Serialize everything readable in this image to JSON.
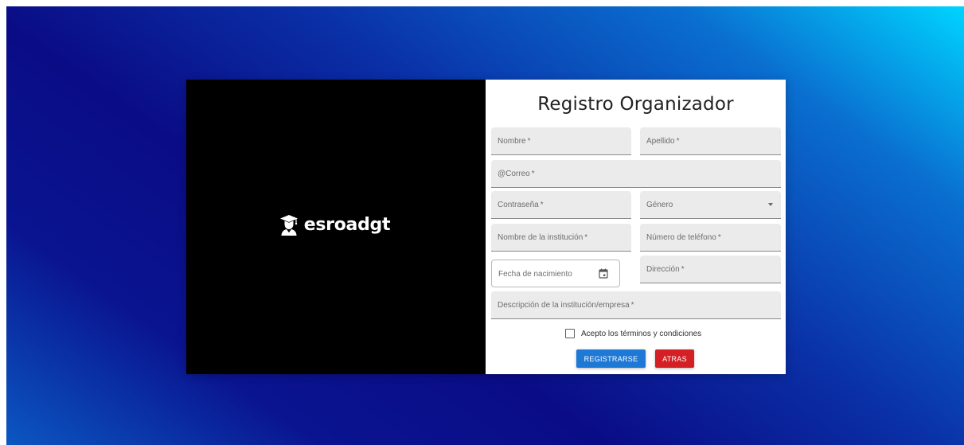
{
  "brand": {
    "name": "esroadgt",
    "logo": "graduate-logo-icon"
  },
  "form": {
    "title": "Registro Organizador",
    "fields": {
      "nombre": {
        "label": "Nombre",
        "required": "*"
      },
      "apellido": {
        "label": "Apellido",
        "required": "*"
      },
      "correo": {
        "label": "@Correo",
        "required": "*"
      },
      "contrasena": {
        "label": "Contraseña",
        "required": "*"
      },
      "genero": {
        "label": "Género",
        "icon": "dropdown-arrow-icon"
      },
      "institucion": {
        "label": "Nombre de la institución",
        "required": "*"
      },
      "telefono": {
        "label": "Número de teléfono",
        "required": "*"
      },
      "fecha": {
        "label": "Fecha de nacimiento",
        "icon": "calendar-icon"
      },
      "direccion": {
        "label": "Dirección",
        "required": "*"
      },
      "descripcion": {
        "label": "Descripción de la institución/empresa",
        "required": "*"
      }
    },
    "terms_label": "Acepto los términos y condiciones",
    "terms_checked": false,
    "buttons": {
      "register": "REGISTRARSE",
      "back": "ATRAS"
    }
  },
  "colors": {
    "primary_button": "#1e79d6",
    "danger_button": "#d42025",
    "left_panel": "#000000",
    "background_gradient": [
      "#00d4ff",
      "#0a2fa6",
      "#0a0c86",
      "#0b57c2"
    ]
  }
}
